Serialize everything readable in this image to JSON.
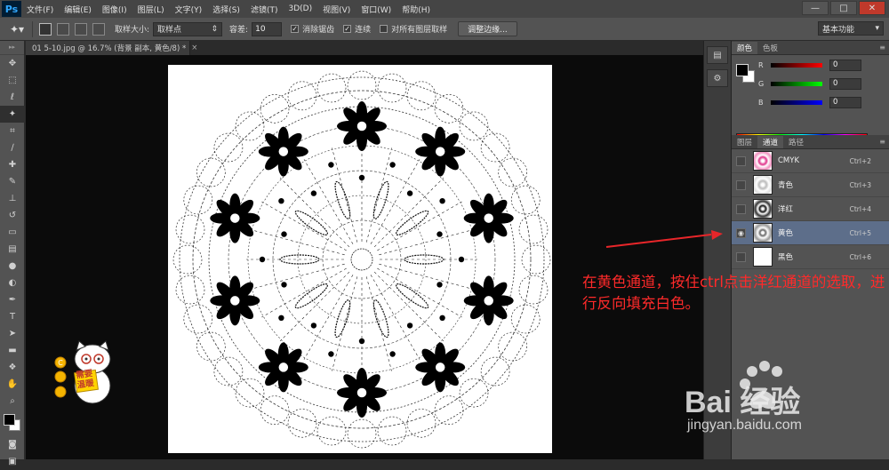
{
  "app": {
    "logo": "Ps"
  },
  "menu": [
    "文件(F)",
    "编辑(E)",
    "图像(I)",
    "图层(L)",
    "文字(Y)",
    "选择(S)",
    "滤镜(T)",
    "3D(D)",
    "视图(V)",
    "窗口(W)",
    "帮助(H)"
  ],
  "window_controls": {
    "minimize": "—",
    "restore": "□",
    "close": "✕"
  },
  "options": {
    "sample_size_label": "取样大小:",
    "sample_size_value": "取样点",
    "tolerance_label": "容差:",
    "tolerance_value": "10",
    "antialias_label": "消除锯齿",
    "antialias_checked": "✓",
    "contiguous_label": "连续",
    "contiguous_checked": "✓",
    "all_layers_label": "对所有图层取样",
    "refine_edge_label": "调整边缘...",
    "workspace_value": "基本功能"
  },
  "document": {
    "tab_title": "01 5-10.jpg @ 16.7% (背景 副本, 黄色/8) *",
    "tab_close": "×"
  },
  "color_panel": {
    "tabs": [
      "颜色",
      "色板"
    ],
    "sliders": [
      {
        "label": "R",
        "value": "0",
        "color": "#ff0000"
      },
      {
        "label": "G",
        "value": "0",
        "color": "#00ff00"
      },
      {
        "label": "B",
        "value": "0",
        "color": "#0000ff"
      }
    ]
  },
  "layers_panel": {
    "tabs": [
      "图层",
      "通道",
      "路径"
    ],
    "channels": [
      {
        "name": "CMYK",
        "shortcut": "Ctrl+2",
        "visible": false,
        "selected": false
      },
      {
        "name": "青色",
        "shortcut": "Ctrl+3",
        "visible": false,
        "selected": false
      },
      {
        "name": "洋红",
        "shortcut": "Ctrl+4",
        "visible": false,
        "selected": false
      },
      {
        "name": "黄色",
        "shortcut": "Ctrl+5",
        "visible": true,
        "selected": true
      },
      {
        "name": "黑色",
        "shortcut": "Ctrl+6",
        "visible": false,
        "selected": false
      }
    ]
  },
  "annotation": {
    "text": "在黄色通道，按住ctrl点击洋红通道的选取，进行反向填充白色。"
  },
  "mascot": {
    "sign_text": "需要温暖"
  },
  "watermark": {
    "brand": "Bai 经验",
    "url": "jingyan.baidu.com"
  },
  "colors": {
    "annotation": "#ff2a2a",
    "selected_row": "#5d6e8a",
    "canvas_bg": "#0b0b0b"
  }
}
